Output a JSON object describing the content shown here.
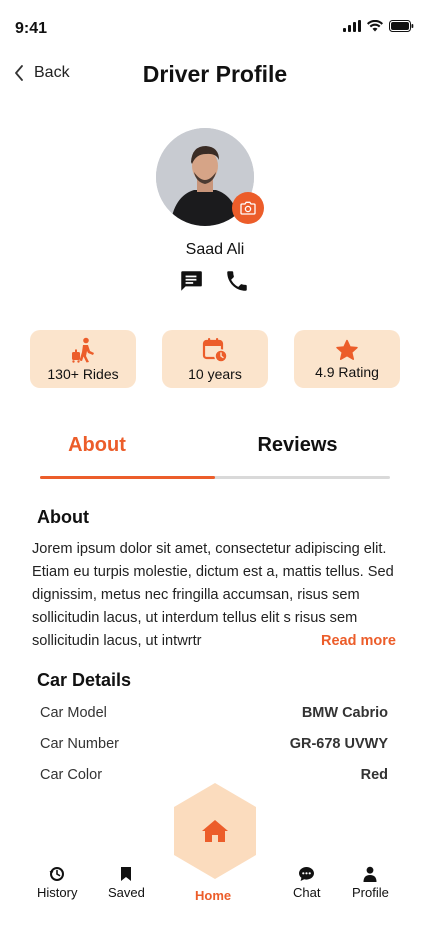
{
  "status_bar": {
    "time": "9:41"
  },
  "header": {
    "back_label": "Back",
    "title": "Driver Profile"
  },
  "driver": {
    "name": "Saad Ali"
  },
  "stats": [
    {
      "icon": "walking-passenger-icon",
      "label": "130+ Rides"
    },
    {
      "icon": "calendar-clock-icon",
      "label": "10 years"
    },
    {
      "icon": "star-icon",
      "label": "4.9 Rating"
    }
  ],
  "tabs": {
    "about": "About",
    "reviews": "Reviews",
    "active": "About"
  },
  "about": {
    "title": "About",
    "text": "Jorem ipsum dolor sit amet, consectetur adipiscing elit. Etiam eu turpis molestie, dictum est a, mattis tellus. Sed dignissim, metus nec fringilla accumsan, risus sem sollicitudin lacus, ut interdum tellus elit s risus sem sollicitudin lacus, ut intwrtr",
    "read_more": "Read more"
  },
  "car_details": {
    "title": "Car Details",
    "rows": [
      {
        "key": "Car Model",
        "value": "BMW Cabrio"
      },
      {
        "key": "Car Number",
        "value": "GR-678 UVWY"
      },
      {
        "key": "Car Color",
        "value": "Red"
      }
    ]
  },
  "bottom_nav": {
    "history": "History",
    "saved": "Saved",
    "home": "Home",
    "chat": "Chat",
    "profile": "Profile",
    "active": "Home"
  },
  "colors": {
    "accent": "#ec5d2a",
    "stat_bg": "#fbe4cc",
    "home_hex": "#fbdcbe"
  }
}
